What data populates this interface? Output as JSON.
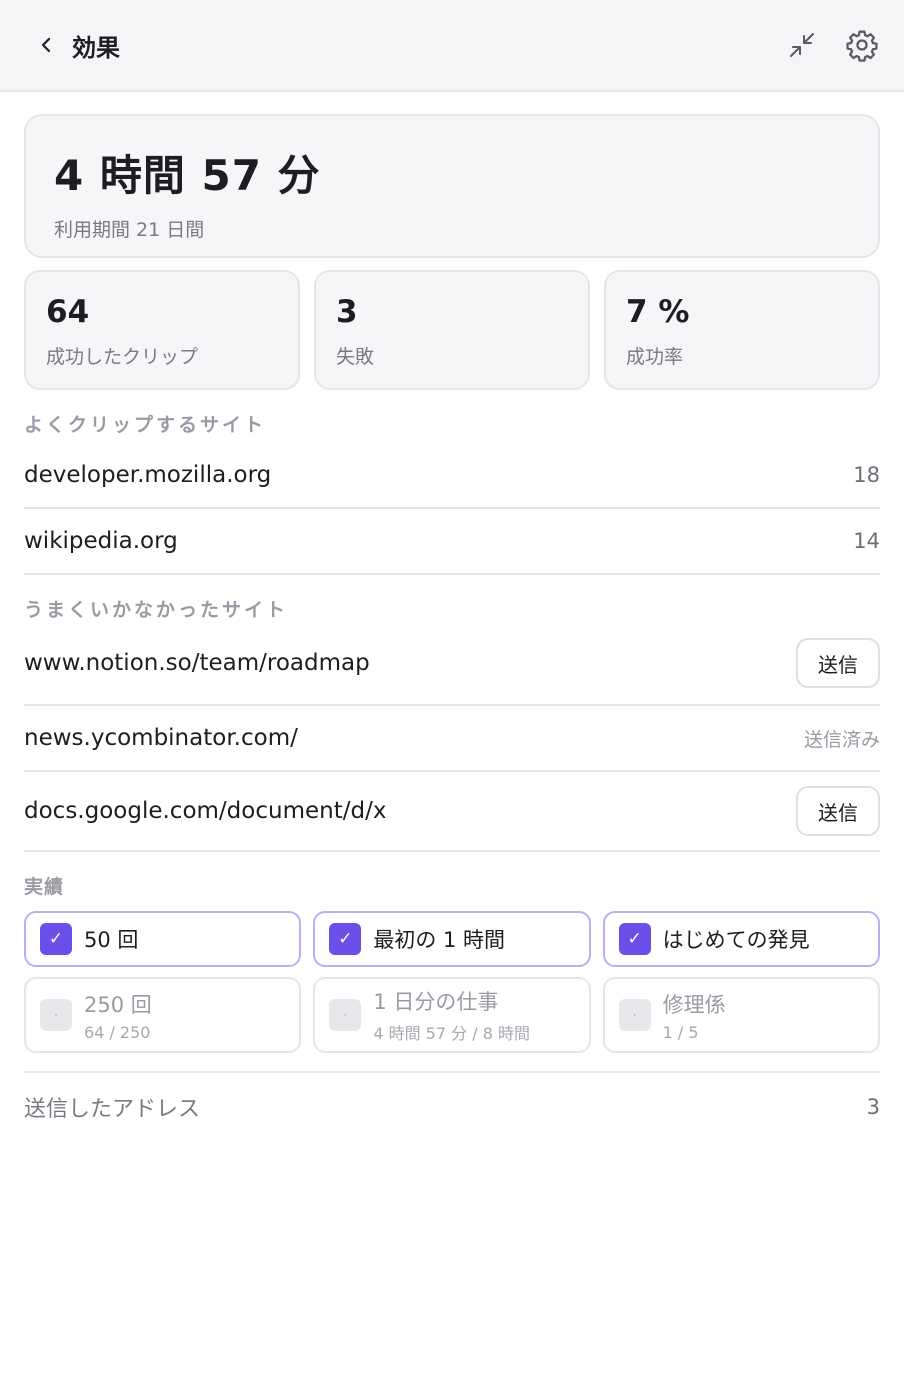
{
  "header": {
    "title": "効果",
    "back_icon": "chevron-left-icon",
    "collapse_icon": "minimize-icon",
    "settings_icon": "gear-icon"
  },
  "summary": {
    "time_saved": "4 時間 57 分",
    "period": "利用期間 21 日間"
  },
  "stats": [
    {
      "value": "64",
      "label": "成功したクリップ"
    },
    {
      "value": "3",
      "label": "失敗"
    },
    {
      "value": "7 %",
      "label": "成功率"
    }
  ],
  "top_sites": {
    "heading": "よくクリップするサイト",
    "items": [
      {
        "name": "developer.mozilla.org",
        "count": "18"
      },
      {
        "name": "wikipedia.org",
        "count": "14"
      }
    ]
  },
  "failed_sites": {
    "heading": "うまくいかなかったサイト",
    "send_label": "送信",
    "sent_label": "送信済み",
    "items": [
      {
        "name": "www.notion.so/team/roadmap"
      },
      {
        "name": "news.ycombinator.com/"
      },
      {
        "name": "docs.google.com/document/d/x"
      }
    ]
  },
  "achievements": {
    "heading": "実績",
    "check_mark": "✓",
    "empty_mark": "·",
    "done": [
      {
        "title": "50 回"
      },
      {
        "title": "最初の 1 時間"
      },
      {
        "title": "はじめての発見"
      }
    ],
    "todo": [
      {
        "title": "250 回",
        "progress": "64 / 250"
      },
      {
        "title": "1 日分の仕事",
        "progress": "4 時間 57 分 / 8 時間"
      },
      {
        "title": "修理係",
        "progress": "1 / 5"
      }
    ]
  },
  "footer": {
    "label": "送信したアドレス",
    "count": "3"
  },
  "colors": {
    "accent": "#6b4fe8",
    "accent_border": "#b9b0f2",
    "muted": "#7a7a84",
    "border": "#e6e6ea"
  }
}
